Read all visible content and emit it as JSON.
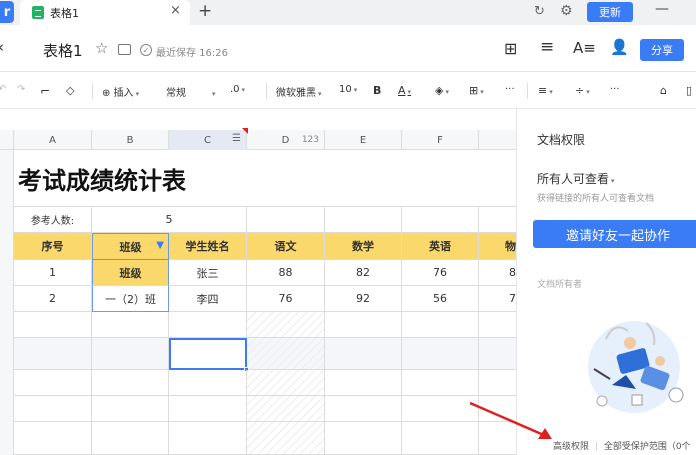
{
  "tabbar": {
    "tab_title": "表格1",
    "tab_close": "×",
    "add_tab": "+",
    "update_label": "更新",
    "minimize": "—"
  },
  "titlebar": {
    "doc_title": "表格1",
    "saved_text": "最近保存 16:26",
    "share_label": "分享"
  },
  "toolbar": {
    "insert_label": "插入",
    "format_label": "常规",
    "decimal_label": ".0",
    "font_label": "微软雅黑",
    "size_label": "10",
    "bold_label": "B",
    "font_color_label": "A",
    "more_1": "···",
    "more_2": "···"
  },
  "sheet": {
    "columns": [
      "A",
      "B",
      "C",
      "D",
      "E",
      "F"
    ],
    "col_d_type": "123",
    "title": "考试成绩统计表",
    "count_label": "参考人数:",
    "count_value": "5",
    "headers": [
      "序号",
      "班级",
      "学生姓名",
      "语文",
      "数学",
      "英语",
      "物"
    ],
    "rows": [
      [
        "1",
        "班级",
        "张三",
        "88",
        "82",
        "76",
        "8"
      ],
      [
        "2",
        "一（2）班",
        "李四",
        "76",
        "92",
        "56",
        "7"
      ]
    ]
  },
  "panel": {
    "title": "文档权限",
    "scope": "所有人可查看",
    "scope_desc": "获得链接的所有人可查看文档",
    "invite_label": "邀请好友一起协作",
    "owner_text": "文档所有者",
    "advanced_label": "高级权限",
    "protect_label": "全部受保护范围（0个",
    "separator": "|"
  },
  "colors": {
    "accent": "#3a7bf6",
    "header_fill": "#fbd86b",
    "arrow": "#e02020"
  }
}
